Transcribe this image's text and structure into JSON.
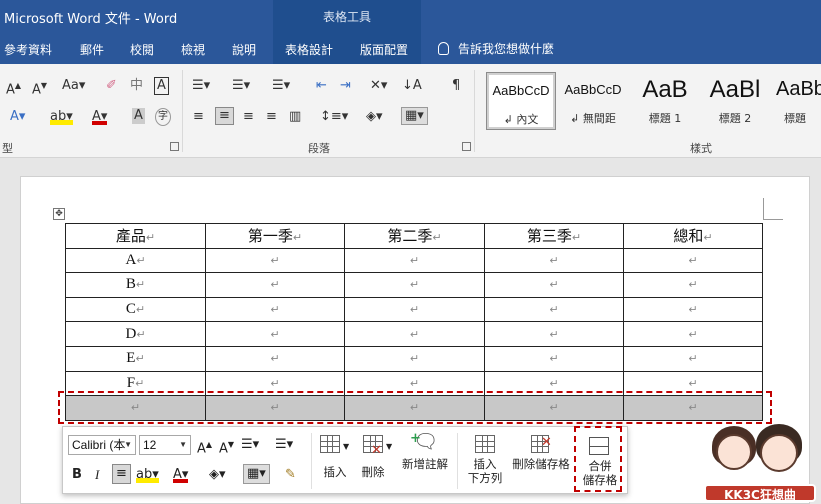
{
  "window": {
    "title": "Microsoft Word 文件 - Word",
    "context_tab_group": "表格工具"
  },
  "tabs": [
    "參考資料",
    "郵件",
    "校閱",
    "檢視",
    "說明",
    "表格設計",
    "版面配置"
  ],
  "tell_me": "告訴我您想做什麼",
  "ribbon": {
    "font_group_label": "型",
    "paragraph_group_label": "段落",
    "styles_group_label": "樣式",
    "styles": [
      {
        "sample": "AaBbCcD",
        "name": "內文"
      },
      {
        "sample": "AaBbCcD",
        "name": "無間距"
      },
      {
        "sample": "AaB",
        "name": "標題 1"
      },
      {
        "sample": "AaBl",
        "name": "標題 2"
      },
      {
        "sample": "AaBb",
        "name": "標題"
      }
    ]
  },
  "table": {
    "header": [
      "產品",
      "第一季",
      "第二季",
      "第三季",
      "總和"
    ],
    "rows": [
      [
        "A"
      ],
      [
        "B"
      ],
      [
        "C"
      ],
      [
        "D"
      ],
      [
        "E"
      ],
      [
        "F"
      ],
      [
        ""
      ]
    ],
    "paragraph_mark": "↵"
  },
  "mini_toolbar": {
    "font_name": "Calibri (本",
    "font_size": "12",
    "insert_label": "插入",
    "delete_label": "刪除",
    "new_comment_label": "新增註解",
    "insert_below_label_1": "插入",
    "insert_below_label_2": "下方列",
    "delete_cells_label": "刪除儲存格",
    "merge_label_1": "合併",
    "merge_label_2": "儲存格"
  },
  "logo": {
    "text": "KK3C狂想曲"
  },
  "colors": {
    "title_bar": "#2b579a",
    "highlight": "#c00000"
  }
}
